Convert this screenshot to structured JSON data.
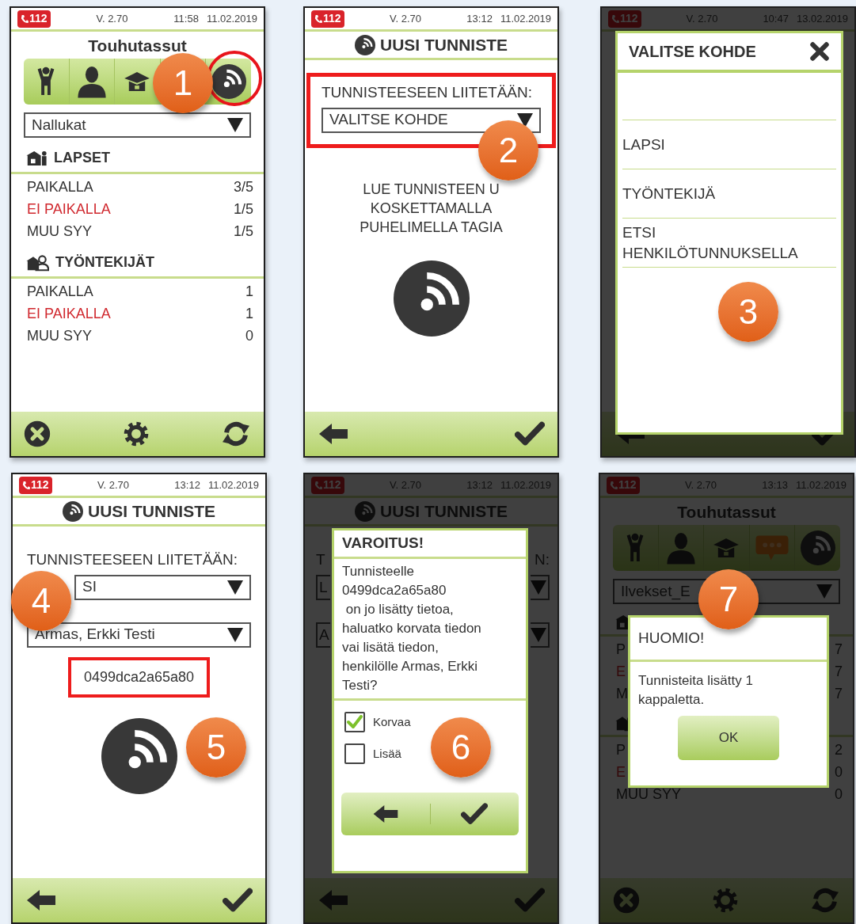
{
  "screens": [
    {
      "kind": "home",
      "dimmed": false,
      "status": {
        "emergency": "112",
        "version": "V. 2.70",
        "time": "11:58",
        "date": "11.02.2019"
      },
      "title": "Touhutassut",
      "chat_button_visible": false,
      "tag_button_circled": true,
      "group": "Nallukat",
      "sections": [
        {
          "kind": "children",
          "title": "LAPSET",
          "rows": [
            {
              "label": "PAIKALLA",
              "value": "3/5",
              "absent": false
            },
            {
              "label": "EI PAIKALLA",
              "value": "1/5",
              "absent": true
            },
            {
              "label": "MUU SYY",
              "value": "1/5",
              "absent": false
            }
          ]
        },
        {
          "kind": "staff",
          "title": "TYÖNTEKIJÄT",
          "rows": [
            {
              "label": "PAIKALLA",
              "value": "1",
              "absent": false
            },
            {
              "label": "EI PAIKALLA",
              "value": "1",
              "absent": true
            },
            {
              "label": "MUU SYY",
              "value": "0",
              "absent": false
            }
          ]
        }
      ],
      "badges": [
        "1"
      ]
    },
    {
      "kind": "tag",
      "dimmed": false,
      "status": {
        "emergency": "112",
        "version": "V. 2.70",
        "time": "13:12",
        "date": "11.02.2019"
      },
      "title": "UUSI TUNNISTE",
      "label_parts": [
        "TUNNISTEESEEN LIITETÄÄN:"
      ],
      "selection_boxed": true,
      "selects": [
        "VALITSE KOHDE"
      ],
      "instruction": "LUE TUNNISTEEN U\nKOSKETTAMALLA\nPUHELIMELLA TAGIA",
      "badges": [
        "2"
      ]
    },
    {
      "kind": "tag",
      "dimmed": true,
      "status": {
        "emergency": "112",
        "version": "V. 2.70",
        "time": "10:47",
        "date": "13.02.2019"
      },
      "dialog": {
        "kind": "picker",
        "title": "VALITSE KOHDE",
        "options": [
          "LAPSI",
          "TYÖNTEKIJÄ",
          "ETSI\nHENKILÖTUNNUKSELLA"
        ]
      },
      "badges": [
        "3"
      ]
    },
    {
      "kind": "tag",
      "dimmed": false,
      "status": {
        "emergency": "112",
        "version": "V. 2.70",
        "time": "13:12",
        "date": "11.02.2019"
      },
      "title": "UUSI TUNNISTE",
      "label_parts": [
        "TUNNISTEESEEN LIITETÄÄN:"
      ],
      "selection_boxed": false,
      "selects": [
        "SI",
        "Armas, Erkki Testi"
      ],
      "tag_id": "0499dca2a65a80",
      "tag_id_boxed": true,
      "badges": [
        "4",
        "5"
      ]
    },
    {
      "kind": "tag",
      "dimmed": true,
      "status": {
        "emergency": "112",
        "version": "V. 2.70",
        "time": "13:12",
        "date": "11.02.2019"
      },
      "title": "UUSI TUNNISTE",
      "label_parts": [
        "T",
        "N:"
      ],
      "selection_boxed": false,
      "selects": [
        "L",
        "A"
      ],
      "dialog": {
        "kind": "warning",
        "title": "VAROITUS!",
        "message": "Tunnisteelle\n0499dca2a65a80\n on jo lisätty tietoa,\nhaluatko korvata tiedon\nvai lisätä tiedon,\nhenkilölle Armas, Erkki\nTesti?",
        "options": [
          {
            "label": "Korvaa",
            "checked": true
          },
          {
            "label": "Lisää",
            "checked": false
          }
        ]
      },
      "badges": [
        "6"
      ]
    },
    {
      "kind": "home",
      "dimmed": true,
      "status": {
        "emergency": "112",
        "version": "V. 2.70",
        "time": "13:13",
        "date": "11.02.2019"
      },
      "title": "Touhutassut",
      "chat_button_visible": true,
      "tag_button_circled": false,
      "group": "Ilvekset_E",
      "sections": [
        {
          "kind": "children",
          "rows": [
            {
              "label": "P",
              "value": "7",
              "absent": false
            },
            {
              "label": "E",
              "value": "7",
              "absent": true
            },
            {
              "label": "M",
              "value": "7",
              "absent": false
            }
          ]
        },
        {
          "kind": "staff",
          "rows": [
            {
              "label": "P",
              "value": "2",
              "absent": false
            },
            {
              "label": "E",
              "value": "0",
              "absent": true
            },
            {
              "label": "MUU SYY",
              "value": "0",
              "absent": false
            }
          ]
        }
      ],
      "dialog": {
        "kind": "info",
        "title": "HUOMIO!",
        "message": "Tunnisteita lisätty 1\nkappaletta.",
        "button": "OK"
      },
      "badges": [
        "7"
      ]
    }
  ]
}
